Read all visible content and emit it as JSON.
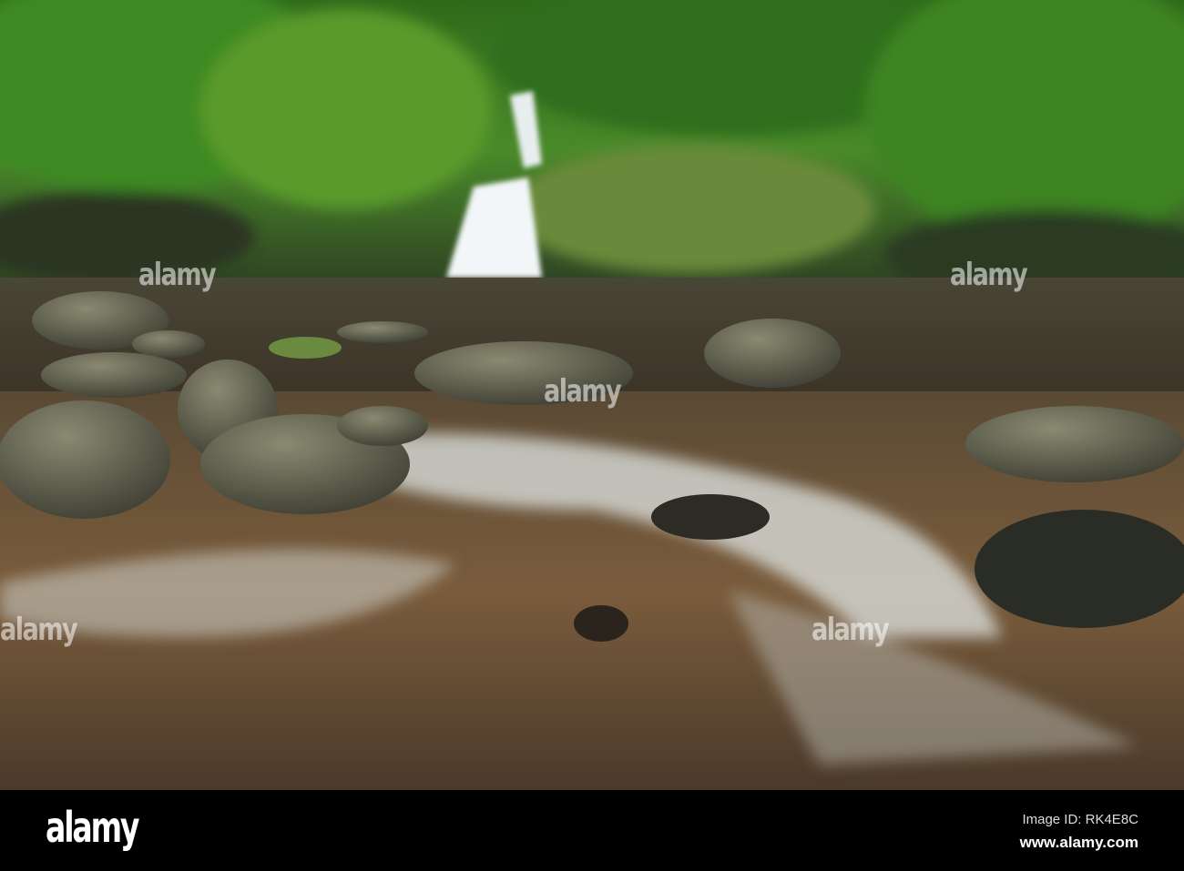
{
  "image": {
    "subject": "waterfall"
  },
  "watermark": {
    "text": "alamy"
  },
  "footer": {
    "logo": "alamy",
    "image_id": "Image ID: RK4E8C",
    "url": "www.alamy.com"
  },
  "colors": {
    "foliage": "#3f7a22",
    "water": "#6b5236",
    "bar": "#000000"
  }
}
